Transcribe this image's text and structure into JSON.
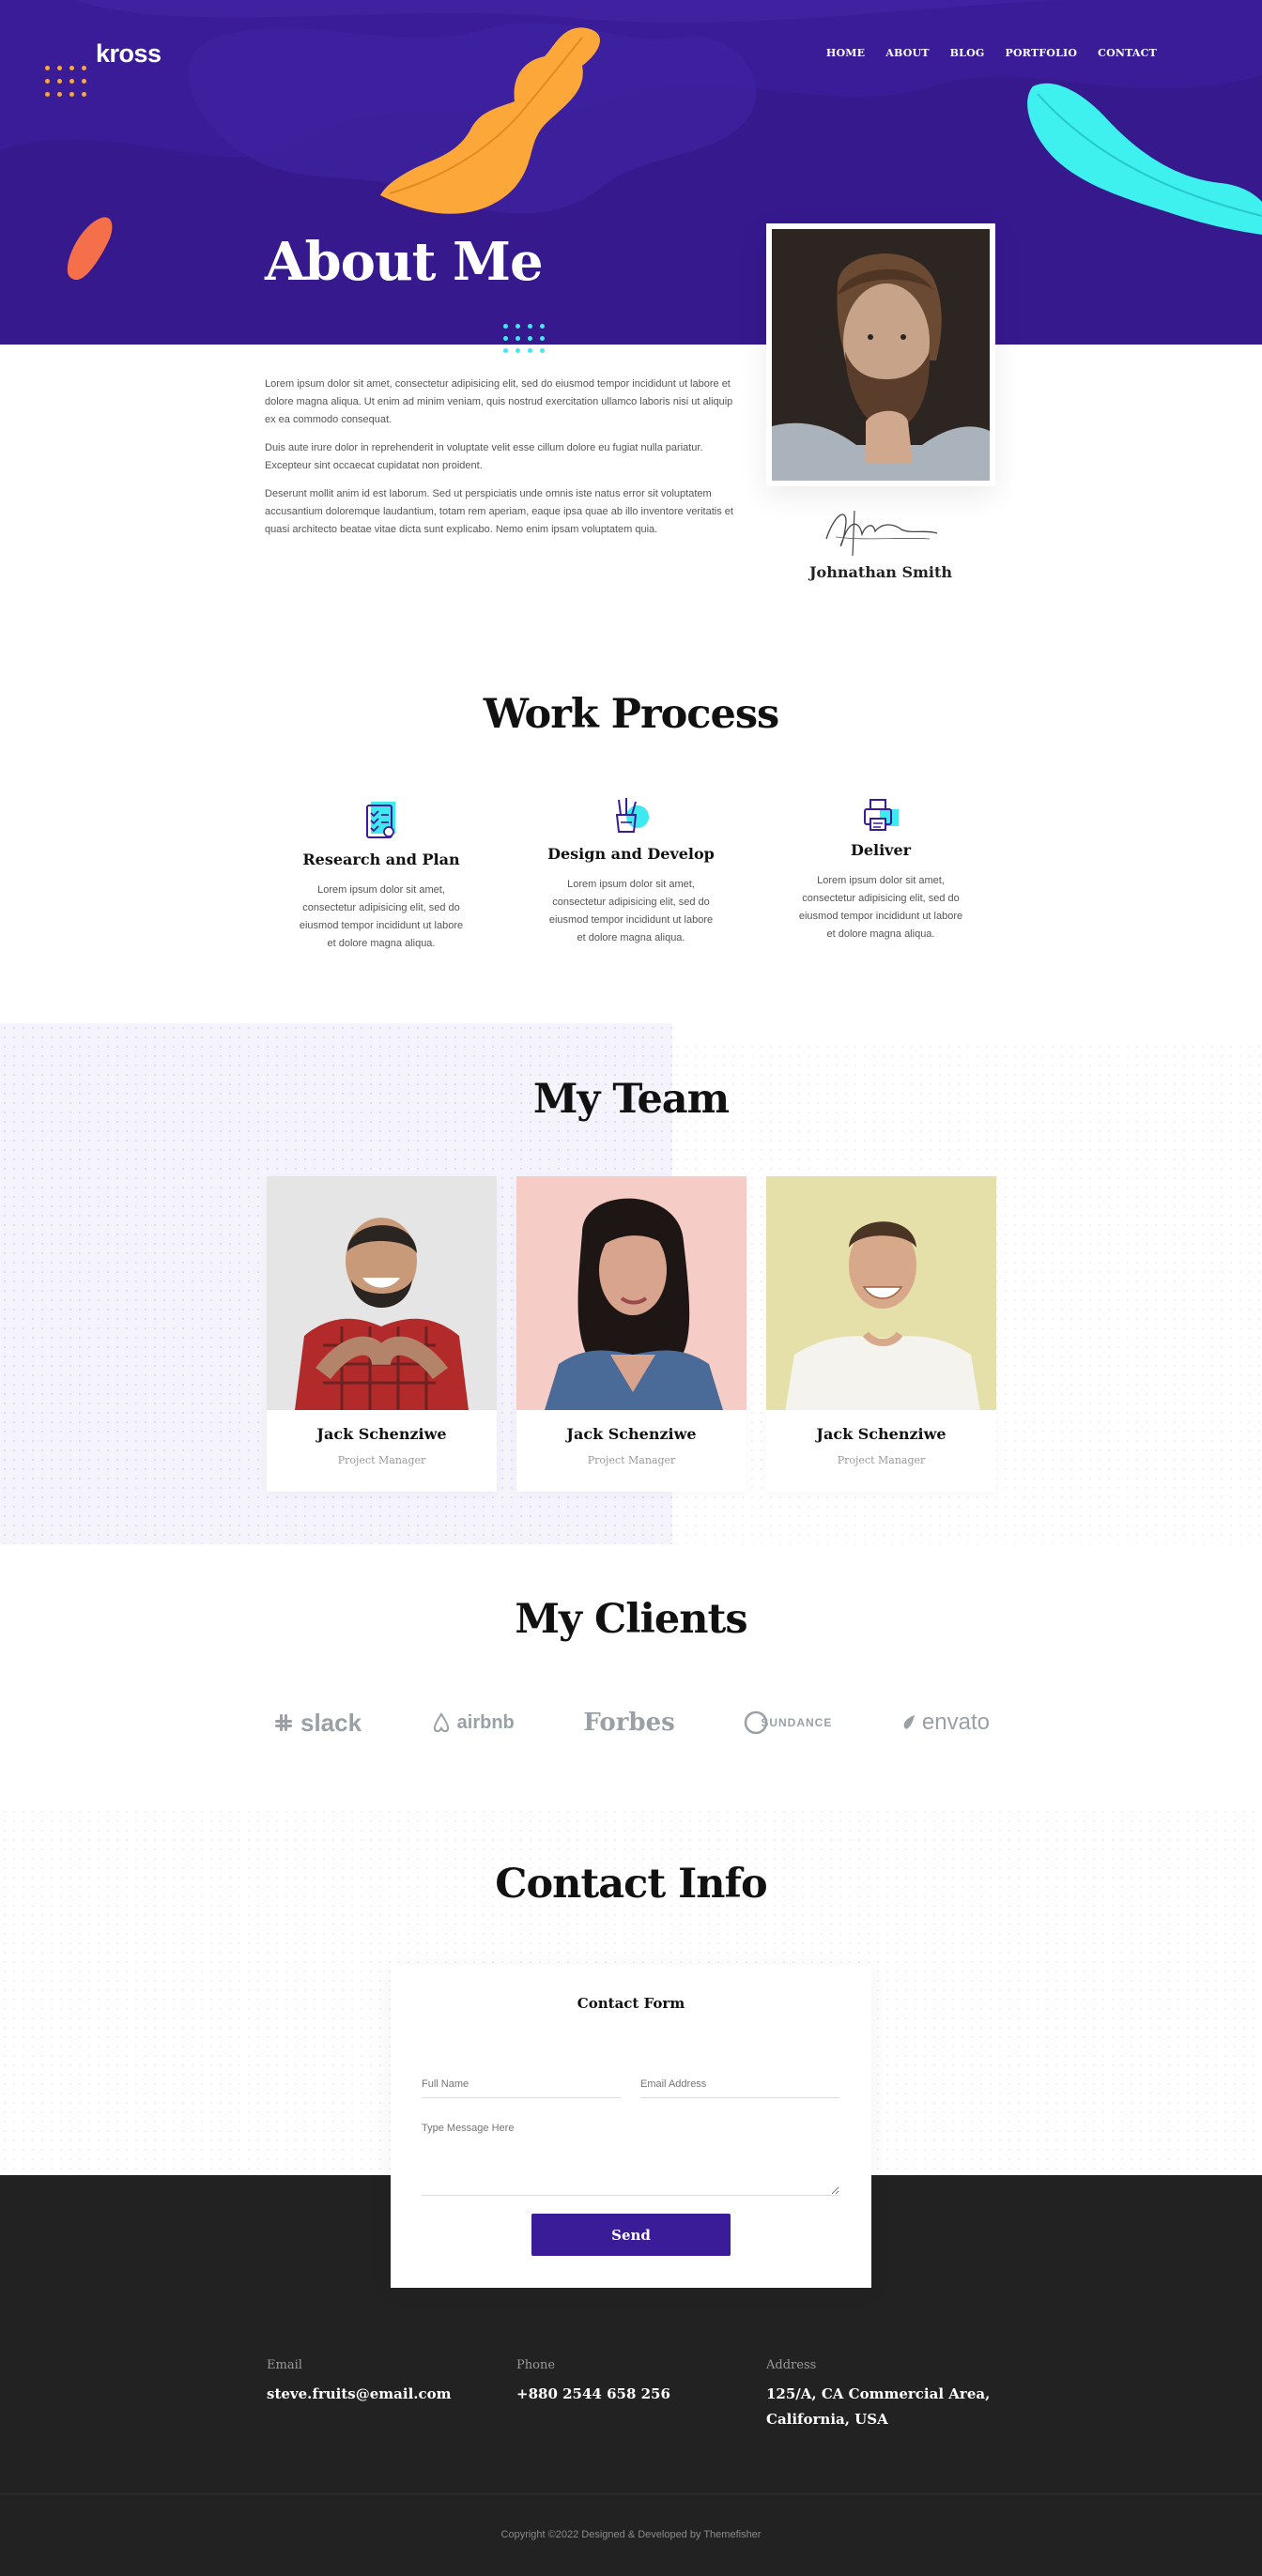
{
  "brand": {
    "logo": "kross"
  },
  "nav": {
    "items": [
      "HOME",
      "ABOUT",
      "BLOG",
      "PORTFOLIO",
      "CONTACT"
    ]
  },
  "about": {
    "title": "About Me",
    "paragraphs": [
      "Lorem ipsum dolor sit amet, consectetur adipisicing elit, sed do eiusmod tempor incididunt ut labore et dolore magna aliqua. Ut enim ad minim veniam, quis nostrud exercitation ullamco laboris nisi ut aliquip ex ea commodo consequat.",
      "Duis aute irure dolor in reprehenderit in voluptate velit esse cillum dolore eu fugiat nulla pariatur. Excepteur sint occaecat cupidatat non proident.",
      "Deserunt mollit anim id est laborum. Sed ut perspiciatis unde omnis iste natus error sit voluptatem accusantium doloremque laudantium, totam rem aperiam, eaque ipsa quae ab illo inventore veritatis et quasi architecto beatae vitae dicta sunt explicabo. Nemo enim ipsam voluptatem quia."
    ],
    "signature_name": "Johnathan Smith"
  },
  "work_process": {
    "title": "Work Process",
    "steps": [
      {
        "title": "Research and Plan",
        "text": "Lorem ipsum dolor sit amet, consectetur adipisicing elit, sed do eiusmod tempor incididunt ut labore et dolore magna aliqua."
      },
      {
        "title": "Design and Develop",
        "text": "Lorem ipsum dolor sit amet, consectetur adipisicing elit, sed do eiusmod tempor incididunt ut labore et dolore magna aliqua."
      },
      {
        "title": "Deliver",
        "text": "Lorem ipsum dolor sit amet, consectetur adipisicing elit, sed do eiusmod tempor incididunt ut labore et dolore magna aliqua."
      }
    ]
  },
  "team": {
    "title": "My Team",
    "members": [
      {
        "name": "Jack Schenziwe",
        "role": "Project Manager"
      },
      {
        "name": "Jack Schenziwe",
        "role": "Project Manager"
      },
      {
        "name": "Jack Schenziwe",
        "role": "Project Manager"
      }
    ]
  },
  "clients": {
    "title": "My Clients",
    "logos": [
      "slack",
      "airbnb",
      "Forbes",
      "SUNDANCE",
      "envato"
    ]
  },
  "contact": {
    "title": "Contact Info",
    "form_title": "Contact Form",
    "name_placeholder": "Full Name",
    "email_placeholder": "Email Address",
    "message_placeholder": "Type Message Here",
    "send_label": "Send"
  },
  "footer": {
    "email_label": "Email",
    "email_value": "steve.fruits@email.com",
    "phone_label": "Phone",
    "phone_value": "+880 2544 658 256",
    "address_label": "Address",
    "address_line1": "125/A, CA Commercial Area,",
    "address_line2": "California, USA",
    "copyright": "Copyright ©2022 Designed & Developed by Themefisher"
  },
  "colors": {
    "primary": "#3b1c98",
    "accent_orange": "#fba73a",
    "accent_cyan": "#3ee9f0",
    "accent_coral": "#f5704a",
    "footer_bg": "#222222"
  }
}
